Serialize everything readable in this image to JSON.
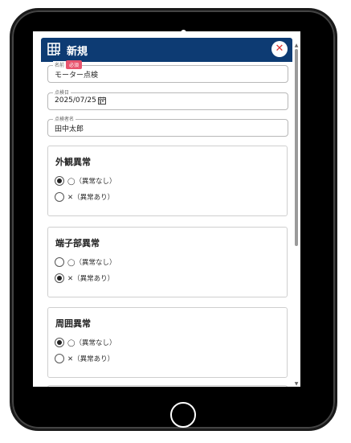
{
  "header": {
    "title": "新規"
  },
  "form": {
    "name": {
      "label": "名前",
      "required_badge": "必須",
      "value": "モーター点検"
    },
    "date": {
      "label": "点検日",
      "value": "2025/07/25"
    },
    "inspector": {
      "label": "点検者名",
      "value": "田中太郎"
    }
  },
  "sections": [
    {
      "title": "外観異常",
      "options": [
        {
          "label": "◯（異常なし）",
          "selected": true
        },
        {
          "label": "✕（異常あり）",
          "selected": false
        }
      ]
    },
    {
      "title": "端子部異常",
      "options": [
        {
          "label": "◯（異常なし）",
          "selected": false
        },
        {
          "label": "✕（異常あり）",
          "selected": true
        }
      ]
    },
    {
      "title": "周囲異常",
      "options": [
        {
          "label": "◯（異常なし）",
          "selected": true
        },
        {
          "label": "✕（異常あり）",
          "selected": false
        }
      ]
    }
  ],
  "icons": {
    "header": "grid-table-icon",
    "close": "close-icon",
    "calendar": "calendar-icon"
  },
  "colors": {
    "header_bg": "#0d3b73",
    "badge": "#e8546e",
    "close": "#d33333"
  }
}
